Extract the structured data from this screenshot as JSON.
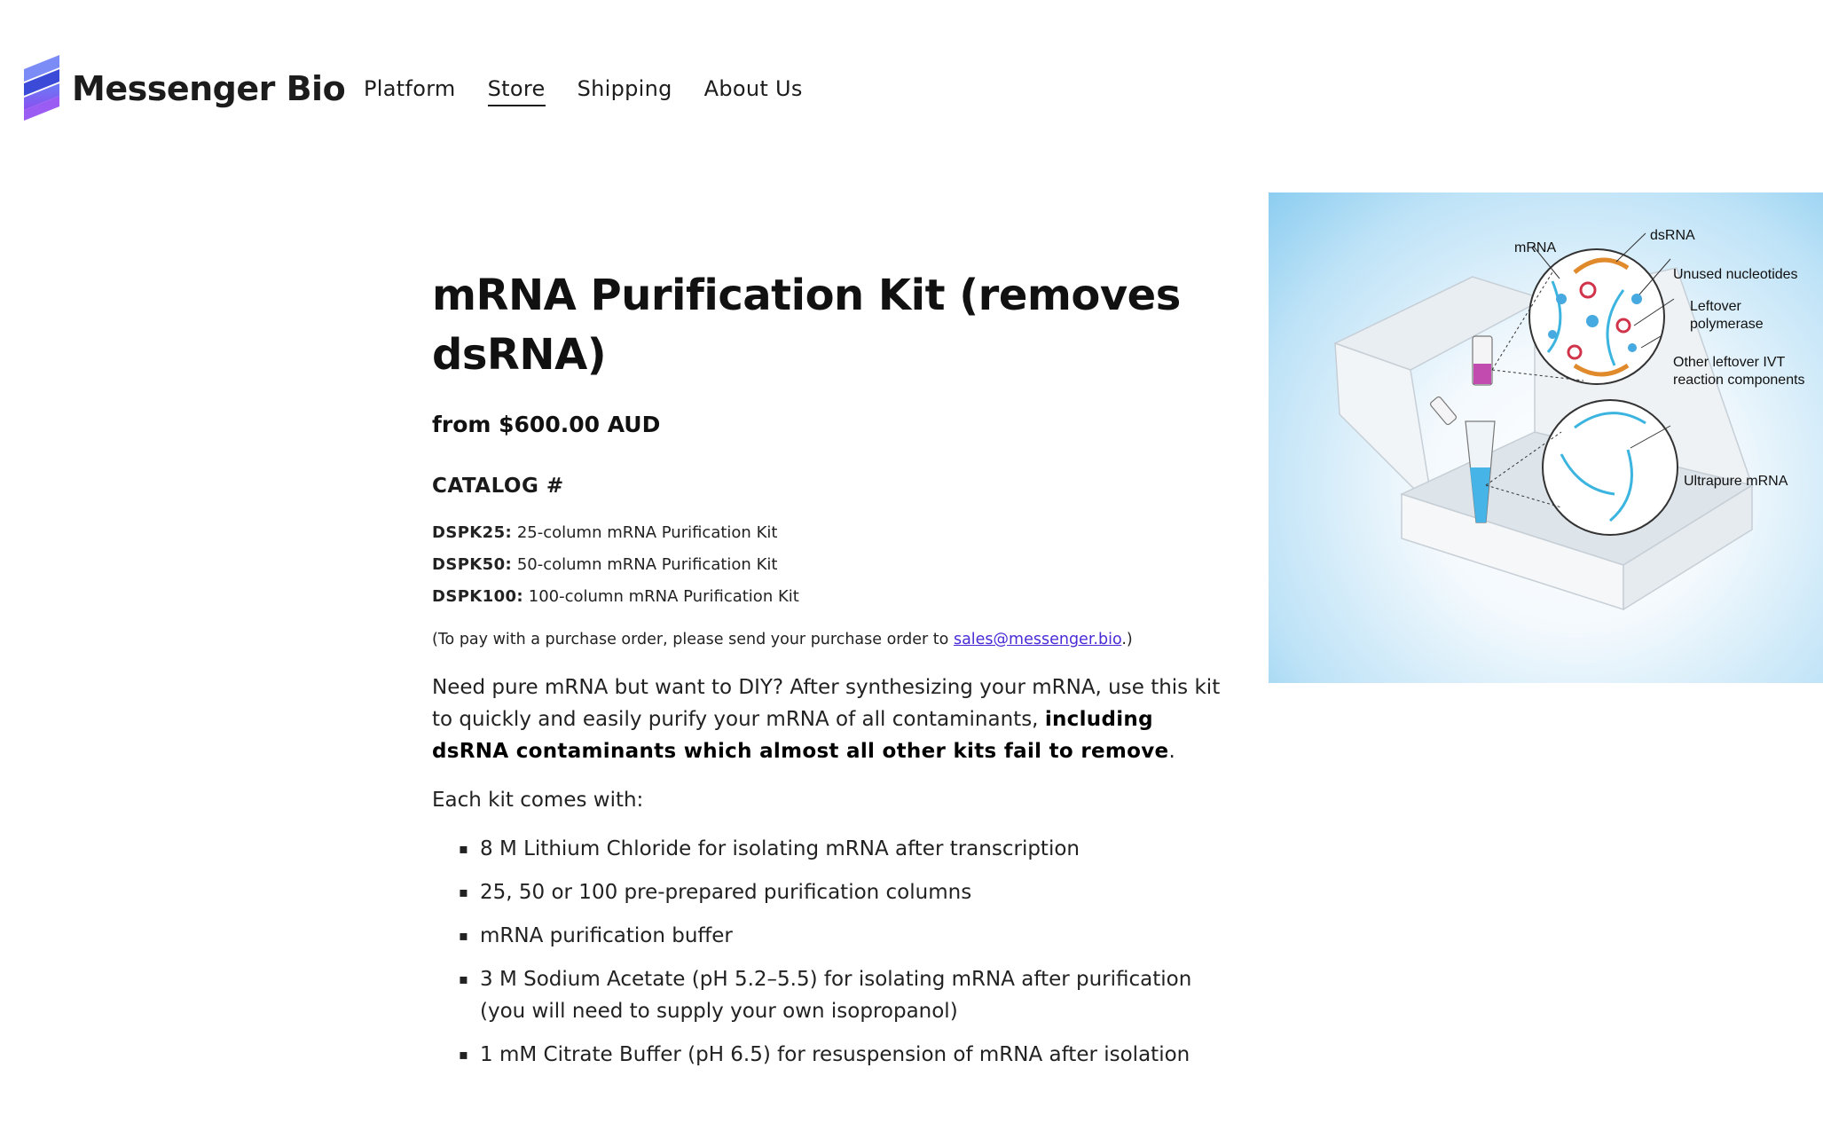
{
  "brand": {
    "name": "Messenger Bio",
    "colors": {
      "logo_gradient_top": "#6a7cf5",
      "logo_gradient_bottom": "#8a4ff0",
      "link": "#4a2bd6"
    }
  },
  "nav": {
    "items": [
      {
        "label": "Platform",
        "active": false
      },
      {
        "label": "Store",
        "active": true
      },
      {
        "label": "Shipping",
        "active": false
      },
      {
        "label": "About Us",
        "active": false
      }
    ]
  },
  "product": {
    "title": "mRNA Purification Kit (removes dsRNA)",
    "price": "from $600.00 AUD",
    "catalog_heading": "CATALOG #",
    "catalog": [
      {
        "code": "DSPK25:",
        "desc": "25-column mRNA Purification Kit"
      },
      {
        "code": "DSPK50:",
        "desc": "50-column mRNA Purification Kit"
      },
      {
        "code": "DSPK100:",
        "desc": "100-column mRNA Purification Kit"
      }
    ],
    "po_note": {
      "before": "(To pay with a purchase order, please send your purchase order to ",
      "email": "sales@messenger.bio",
      "after": ".)"
    },
    "intro": {
      "text": "Need pure mRNA but want to DIY? After synthesizing your mRNA, use this kit to quickly and easily purify your mRNA of all contaminants, ",
      "bold": "including dsRNA contaminants which almost all other kits fail to remove",
      "end": "."
    },
    "comes_with": "Each kit comes with:",
    "items": [
      "8 M Lithium Chloride for isolating mRNA after transcription",
      "25, 50 or 100 pre-prepared purification columns",
      "mRNA purification buffer",
      "3 M Sodium Acetate (pH 5.2–5.5) for isolating mRNA after purification (you will need to supply your own isopropanol)",
      "1 mM Citrate Buffer (pH 6.5) for resuspension of mRNA after isolation"
    ],
    "image_labels": {
      "mrna": "mRNA",
      "dsrna": "dsRNA",
      "unused_nucleotides": "Unused nucleotides",
      "leftover_polymerase_1": "Leftover",
      "leftover_polymerase_2": "polymerase",
      "other_leftover_1": "Other leftover IVT",
      "other_leftover_2": "reaction components",
      "ultrapure": "Ultrapure mRNA"
    }
  }
}
